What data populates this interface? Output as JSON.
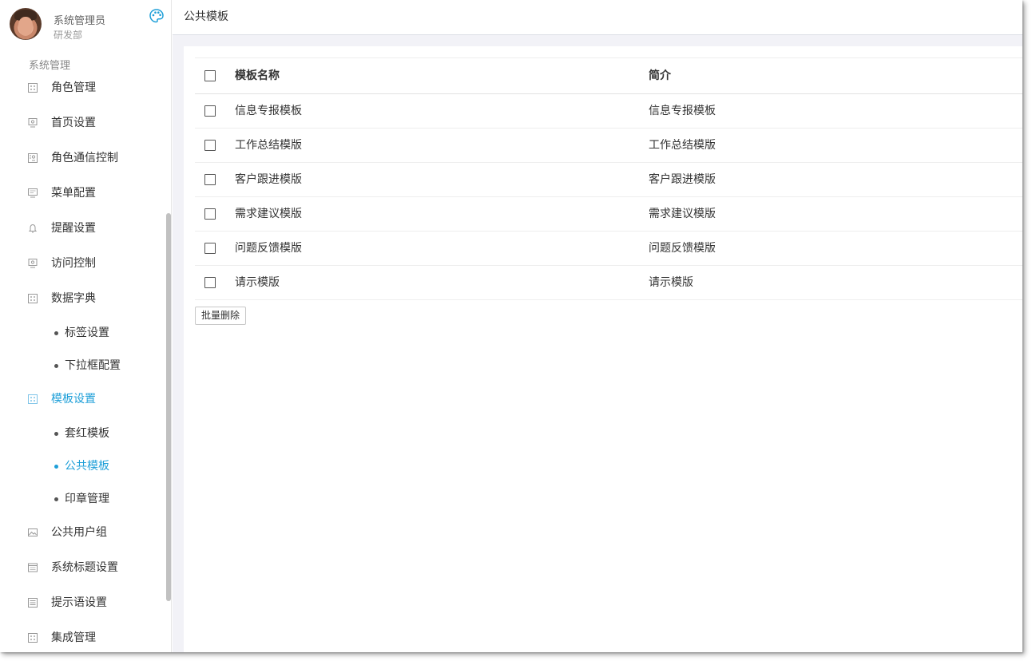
{
  "user": {
    "name": "系统管理员",
    "dept": "研发部"
  },
  "sidebar": {
    "section_title": "系统管理",
    "items": [
      {
        "label": "角色管理",
        "icon": "grid-icon"
      },
      {
        "label": "首页设置",
        "icon": "monitor-icon"
      },
      {
        "label": "角色通信控制",
        "icon": "contact-icon"
      },
      {
        "label": "菜单配置",
        "icon": "screen-icon"
      },
      {
        "label": "提醒设置",
        "icon": "bell-icon"
      },
      {
        "label": "访问控制",
        "icon": "monitor-icon"
      },
      {
        "label": "数据字典",
        "icon": "grid-icon"
      },
      {
        "label": "标签设置",
        "sub": true
      },
      {
        "label": "下拉框配置",
        "sub": true
      },
      {
        "label": "模板设置",
        "icon": "grid-icon",
        "active": true
      },
      {
        "label": "套红模板",
        "sub": true
      },
      {
        "label": "公共模板",
        "sub": true,
        "active": true
      },
      {
        "label": "印章管理",
        "sub": true
      },
      {
        "label": "公共用户组",
        "icon": "image-icon"
      },
      {
        "label": "系统标题设置",
        "icon": "window-icon"
      },
      {
        "label": "提示语设置",
        "icon": "list-icon"
      },
      {
        "label": "集成管理",
        "icon": "grid-icon"
      }
    ]
  },
  "page": {
    "title": "公共模板"
  },
  "table": {
    "columns": [
      "模板名称",
      "简介"
    ],
    "rows": [
      {
        "name": "信息专报模板",
        "desc": "信息专报模板"
      },
      {
        "name": "工作总结模版",
        "desc": "工作总结模版"
      },
      {
        "name": "客户跟进模版",
        "desc": "客户跟进模版"
      },
      {
        "name": "需求建议模版",
        "desc": "需求建议模版"
      },
      {
        "name": "问题反馈模版",
        "desc": "问题反馈模版"
      },
      {
        "name": "请示模版",
        "desc": "请示模版"
      }
    ]
  },
  "actions": {
    "batch_delete": "批量删除"
  },
  "colors": {
    "accent": "#1e9fd8",
    "main_bg": "#f2f2f7"
  }
}
